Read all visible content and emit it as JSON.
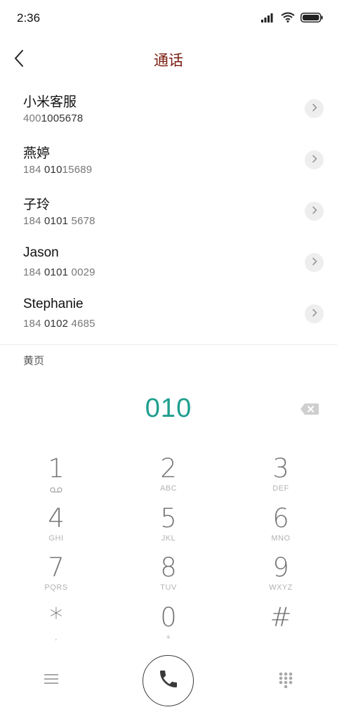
{
  "status_bar": {
    "time": "2:36",
    "icons": [
      "signal-icon",
      "wifi-icon",
      "battery-icon"
    ]
  },
  "header": {
    "title": "通话",
    "back_icon": "chevron-left-icon"
  },
  "contacts": [
    {
      "name": "小米客服",
      "number_pre": "400",
      "number_hl": "1005678",
      "number_post": ""
    },
    {
      "name": "燕婷",
      "number_pre": "184 ",
      "number_hl": "010",
      "number_post": "15689"
    },
    {
      "name": "子玲",
      "number_pre": "184 ",
      "number_hl": "0101",
      "number_post": " 5678"
    },
    {
      "name": "Jason",
      "number_pre": "184 ",
      "number_hl": "0101",
      "number_post": " 0029"
    },
    {
      "name": "Stephanie",
      "number_pre": "184 ",
      "number_hl": "0102",
      "number_post": " 4685"
    }
  ],
  "section_label": "黄页",
  "dial_input": "010",
  "keypad": [
    {
      "digit": "1",
      "letters": "",
      "sub_icon": "voicemail-icon"
    },
    {
      "digit": "2",
      "letters": "ABC"
    },
    {
      "digit": "3",
      "letters": "DEF"
    },
    {
      "digit": "4",
      "letters": "GHI"
    },
    {
      "digit": "5",
      "letters": "JKL"
    },
    {
      "digit": "6",
      "letters": "MNO"
    },
    {
      "digit": "7",
      "letters": "PQRS"
    },
    {
      "digit": "8",
      "letters": "TUV"
    },
    {
      "digit": "9",
      "letters": "WXYZ"
    },
    {
      "digit": "*",
      "letters": ","
    },
    {
      "digit": "0",
      "letters": "+"
    },
    {
      "digit": "#",
      "letters": ""
    }
  ],
  "colors": {
    "title": "#7a1c0f",
    "dial_input": "#1e9e8e",
    "digit": "#777777",
    "letters": "#b3b3b3"
  }
}
